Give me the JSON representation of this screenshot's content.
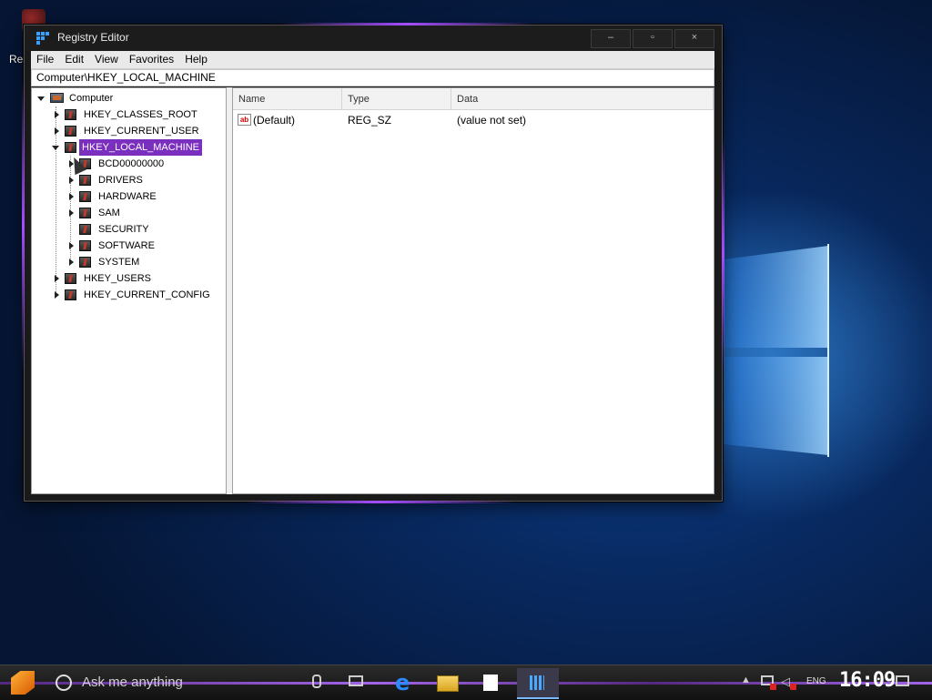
{
  "desktop": {
    "icon_label": "Re"
  },
  "window": {
    "title": "Registry Editor",
    "caption": {
      "minimize": "–",
      "maximize": "▫",
      "close": "×"
    },
    "menu": [
      "File",
      "Edit",
      "View",
      "Favorites",
      "Help"
    ],
    "address": "Computer\\HKEY_LOCAL_MACHINE",
    "tree": {
      "root": "Computer",
      "items": [
        "HKEY_CLASSES_ROOT",
        "HKEY_CURRENT_USER",
        "HKEY_LOCAL_MACHINE",
        "BCD00000000",
        "DRIVERS",
        "HARDWARE",
        "SAM",
        "SECURITY",
        "SOFTWARE",
        "SYSTEM",
        "HKEY_USERS",
        "HKEY_CURRENT_CONFIG"
      ],
      "selected": "HKEY_LOCAL_MACHINE"
    },
    "list": {
      "columns": [
        "Name",
        "Type",
        "Data"
      ],
      "rows": [
        {
          "name": "(Default)",
          "type": "REG_SZ",
          "data": "(value not set)",
          "icon": "ab"
        }
      ]
    }
  },
  "taskbar": {
    "search_placeholder": "Ask me anything",
    "language": "ENG",
    "time": "16:09"
  },
  "colors": {
    "selection": "#7b2fbf",
    "accent_purple": "#a64dff",
    "accent_blue": "#4aa8ff"
  }
}
